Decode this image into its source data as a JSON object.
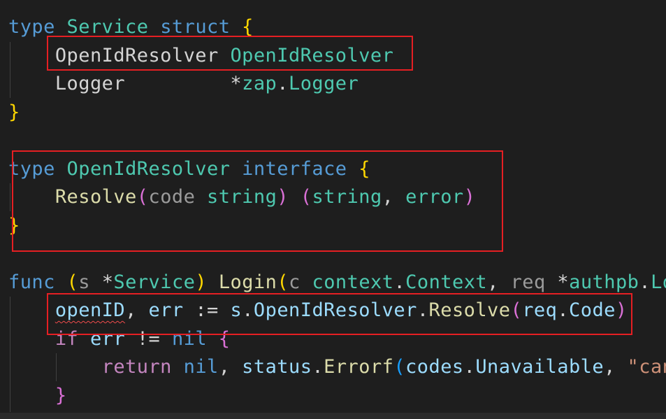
{
  "code": {
    "line1": {
      "kw_type": "type",
      "name": "Service",
      "kw_struct": "struct",
      "brace": "{"
    },
    "line2": {
      "field": "OpenIdResolver",
      "type": "OpenIdResolver"
    },
    "line3": {
      "field": "Logger",
      "pad": "         ",
      "star": "*",
      "pkg": "zap",
      "dot": ".",
      "type": "Logger"
    },
    "line4": {
      "brace": "}"
    },
    "line6": {
      "kw_type": "type",
      "name": "OpenIdResolver",
      "kw_interface": "interface",
      "brace": "{"
    },
    "line7": {
      "method": "Resolve",
      "lp": "(",
      "param": "code",
      "ptype": "string",
      "rp": ")",
      "rlp": "(",
      "r1": "string",
      "comma": ",",
      "r2": "error",
      "rrp": ")"
    },
    "line8": {
      "brace": "}"
    },
    "line10": {
      "kw_func": "func",
      "lp": "(",
      "recv": "s",
      "star": "*",
      "rtype": "Service",
      "rp": ")",
      "method": "Login",
      "lp2": "(",
      "p1": "c",
      "pkg1": "context",
      "dot1": ".",
      "t1": "Context",
      "comma": ",",
      "p2": "req",
      "star2": "*",
      "pkg2": "authpb",
      "dot2": ".",
      "t2": "Lo"
    },
    "line11": {
      "v1": "openID",
      "comma": ",",
      "v2": "err",
      "op": ":=",
      "recv": "s",
      "dot1": ".",
      "field": "OpenIdResolver",
      "dot2": ".",
      "call": "Resolve",
      "lp": "(",
      "arg": "req",
      "dot3": ".",
      "argf": "Code",
      "rp": ")"
    },
    "line12": {
      "kw_if": "if",
      "v": "err",
      "op": "!=",
      "nil": "nil",
      "brace": "{"
    },
    "line13": {
      "kw_return": "return",
      "nil": "nil",
      "comma1": ",",
      "pkg": "status",
      "dot1": ".",
      "call": "Errorf",
      "lp": "(",
      "pkg2": "codes",
      "dot2": ".",
      "const": "Unavailable",
      "comma2": ",",
      "str": "\"can"
    },
    "line14": {
      "brace": "}"
    }
  }
}
